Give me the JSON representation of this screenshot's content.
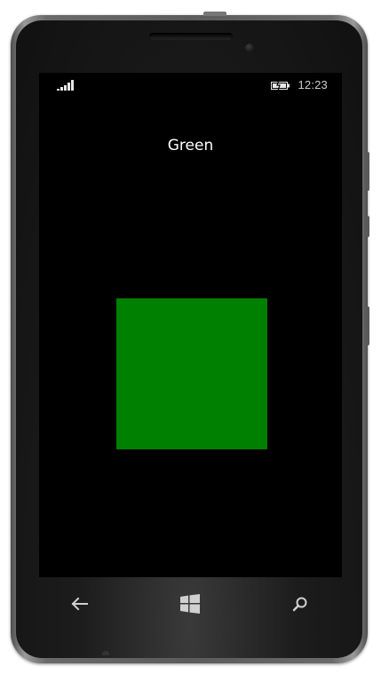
{
  "device": {
    "model": "windows-phone",
    "frame_color": "#5c5c5c",
    "screen_background": "#000000"
  },
  "status_bar": {
    "signal_icon": "signal-strength-icon",
    "battery_icon": "battery-charging-icon",
    "time": "12:23"
  },
  "page": {
    "title": "Green",
    "box_color": "#008000"
  },
  "nav_bar": {
    "back_icon": "back-arrow-icon",
    "start_icon": "windows-start-icon",
    "search_icon": "search-icon"
  }
}
